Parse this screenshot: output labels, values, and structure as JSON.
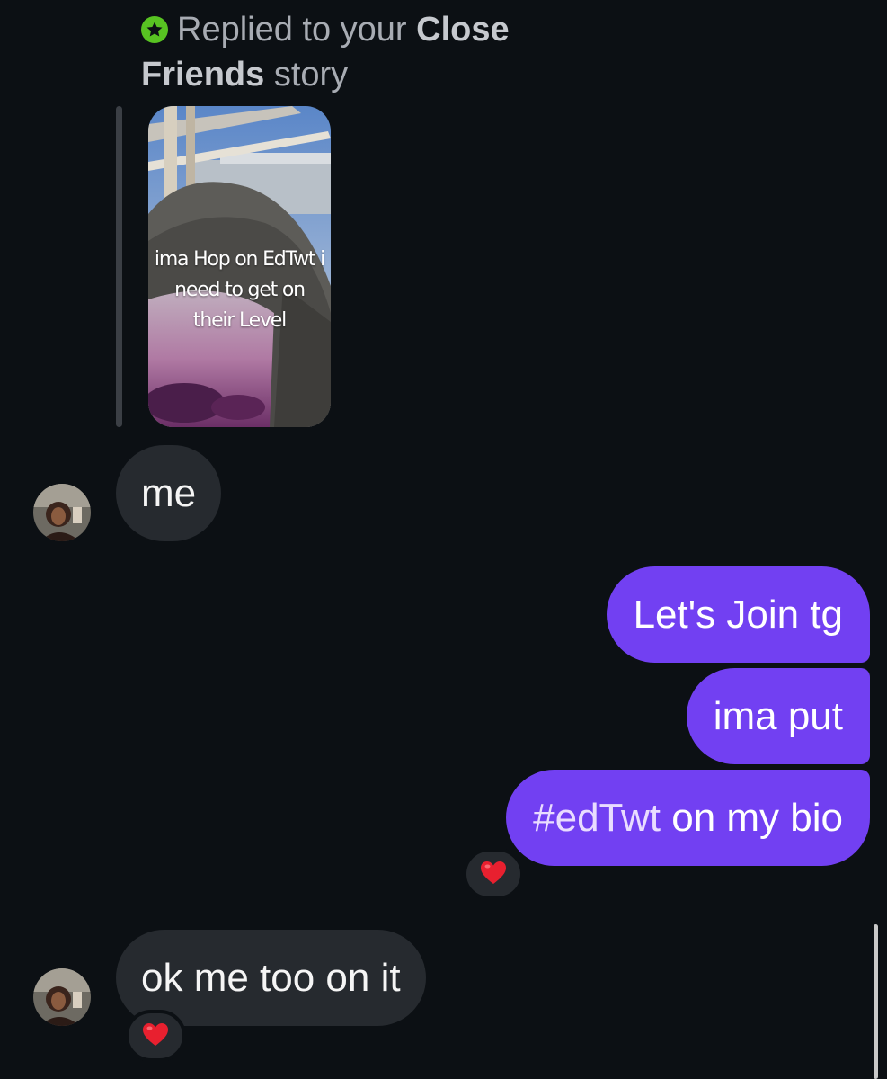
{
  "reply_header": {
    "prefix": "Replied to your",
    "bold_1": "Close",
    "bold_2": "Friends",
    "suffix": "story"
  },
  "story": {
    "caption": "ima Hop on EdTwt i need to get on their Level"
  },
  "messages": [
    {
      "side": "received",
      "text": "me"
    },
    {
      "side": "sent",
      "text": "Let's Join tg"
    },
    {
      "side": "sent",
      "text": "ima put"
    },
    {
      "side": "sent",
      "hashtag": "#edTwt",
      "text": " on my bio",
      "reaction": "❤️"
    },
    {
      "side": "received",
      "text": "ok me too on it",
      "reaction": "❤️"
    }
  ],
  "colors": {
    "background": "#0c1014",
    "sent_bubble": "#7240f2",
    "received_bubble": "#262a2f",
    "close_friends_badge": "#58c322"
  },
  "icons": {
    "close_friends": "star-badge-icon",
    "reaction": "red-heart-icon"
  }
}
